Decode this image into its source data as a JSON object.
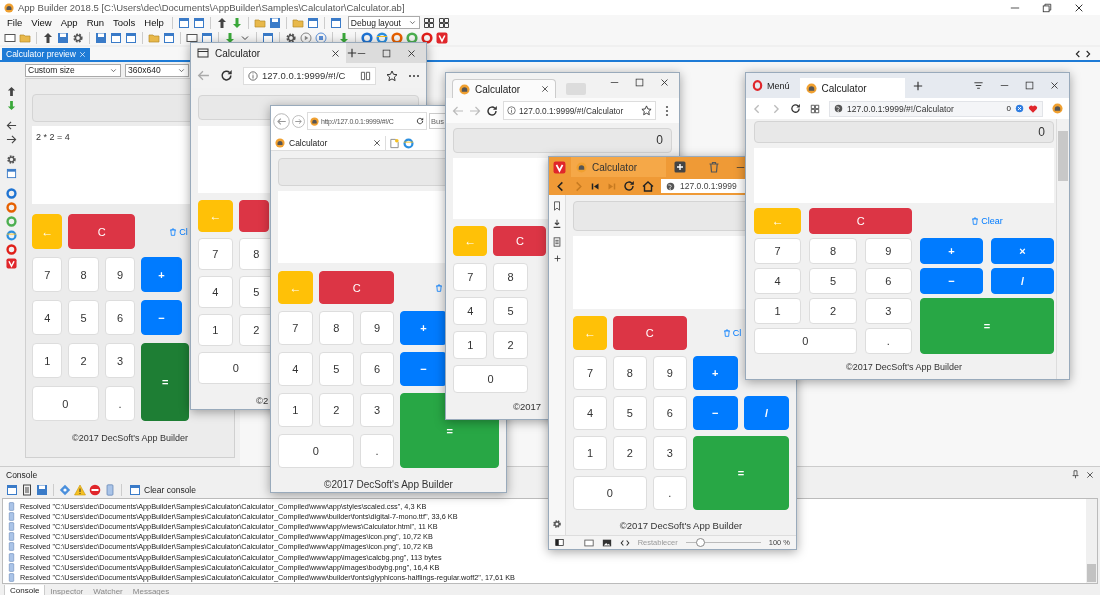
{
  "ide": {
    "title": "App Builder 2018.5 [C:\\Users\\dec\\Documents\\AppBuilder\\Samples\\Calculator\\Calculator.ab]",
    "menu": [
      "File",
      "View",
      "App",
      "Run",
      "Tools",
      "Help"
    ],
    "layout_select": "Debug layout",
    "doc_tabs": [
      {
        "label": "Calculator preview",
        "selected": true
      }
    ],
    "size_select": "Custom size",
    "resolution_select": "360x640",
    "preview": {
      "output": "2 * 2 = 4",
      "back": "←",
      "clear": "C",
      "clear_link": "Cl",
      "keys": [
        [
          {
            "label": "7",
            "kind": "digit"
          },
          {
            "label": "8",
            "kind": "digit"
          },
          {
            "label": "9",
            "kind": "digit"
          },
          {
            "label": "+",
            "kind": "op"
          }
        ],
        [
          {
            "label": "4",
            "kind": "digit"
          },
          {
            "label": "5",
            "kind": "digit"
          },
          {
            "label": "6",
            "kind": "digit"
          },
          {
            "label": "−",
            "kind": "op"
          }
        ],
        [
          {
            "label": "1",
            "kind": "digit"
          },
          {
            "label": "2",
            "kind": "digit"
          },
          {
            "label": "3",
            "kind": "digit"
          },
          {
            "label": "=",
            "kind": "equals",
            "pressed": true
          }
        ],
        [
          {
            "label": "0",
            "kind": "wide"
          },
          {
            "label": ".",
            "kind": "digit"
          }
        ]
      ],
      "footer": "©2017 DecSoft's App Builder"
    },
    "console": {
      "title": "Console",
      "clear_button": "Clear console",
      "lines": [
        "Resolved \"C:\\Users\\dec\\Documents\\AppBuilder\\Samples\\Calculator\\Calculator_Compiled\\www\\app\\styles\\scaled.css\", 4,3 KB",
        "Resolved \"C:\\Users\\dec\\Documents\\AppBuilder\\Samples\\Calculator\\Calculator_Compiled\\www\\builder\\fonts\\digital-7-mono.ttf\", 33,6 KB",
        "Resolved \"C:\\Users\\dec\\Documents\\AppBuilder\\Samples\\Calculator\\Calculator_Compiled\\www\\app\\views\\Calculator.html\", 11 KB",
        "Resolved \"C:\\Users\\dec\\Documents\\AppBuilder\\Samples\\Calculator\\Calculator_Compiled\\www\\app\\images\\icon.png\", 10,72 KB",
        "Resolved \"C:\\Users\\dec\\Documents\\AppBuilder\\Samples\\Calculator\\Calculator_Compiled\\www\\app\\images\\icon.png\", 10,72 KB",
        "Resolved \"C:\\Users\\dec\\Documents\\AppBuilder\\Samples\\Calculator\\Calculator_Compiled\\www\\app\\images\\calcbg.png\", 113 bytes",
        "Resolved \"C:\\Users\\dec\\Documents\\AppBuilder\\Samples\\Calculator\\Calculator_Compiled\\www\\app\\images\\bodybg.png\", 16,4 KB",
        "Resolved \"C:\\Users\\dec\\Documents\\AppBuilder\\Samples\\Calculator\\Calculator_Compiled\\www\\builder\\fonts\\glyphicons-halflings-regular.woff2\", 17,61 KB"
      ],
      "tabs": [
        {
          "label": "Console",
          "selected": true
        },
        {
          "label": "Inspector",
          "selected": false
        },
        {
          "label": "Watcher",
          "selected": false
        },
        {
          "label": "Messages",
          "selected": false
        }
      ]
    }
  },
  "windows": [
    {
      "kind": "edge",
      "tab": "Calculator",
      "address": "127.0.0.1:9999/#!/C",
      "calc": {
        "back": "←",
        "keys": [
          [
            {
              "label": "7",
              "kind": "digit"
            },
            {
              "label": "8",
              "kind": "digit"
            }
          ],
          [
            {
              "label": "4",
              "kind": "digit"
            },
            {
              "label": "5",
              "kind": "digit"
            }
          ],
          [
            {
              "label": "1",
              "kind": "digit"
            },
            {
              "label": "2",
              "kind": "digit"
            }
          ],
          [
            {
              "label": "0",
              "kind": "wide"
            }
          ]
        ],
        "footer": "©2"
      }
    },
    {
      "kind": "ie",
      "address": "http://127.0.0.1:9999/#!/C",
      "search": {
        "placeholder": "Bus"
      },
      "tab": "Calculator",
      "calc": {
        "back": "←",
        "clear": "C",
        "trash_icon": true,
        "keys": [
          [
            {
              "label": "7",
              "kind": "digit"
            },
            {
              "label": "8",
              "kind": "digit"
            },
            {
              "label": "9",
              "kind": "digit"
            },
            {
              "label": "+",
              "kind": "op"
            }
          ],
          [
            {
              "label": "4",
              "kind": "digit"
            },
            {
              "label": "5",
              "kind": "digit"
            },
            {
              "label": "6",
              "kind": "digit"
            },
            {
              "label": "−",
              "kind": "op"
            }
          ],
          [
            {
              "label": "1",
              "kind": "digit"
            },
            {
              "label": "2",
              "kind": "digit"
            },
            {
              "label": "3",
              "kind": "digit"
            },
            {
              "label": "=",
              "kind": "equals",
              "pressed": false
            }
          ],
          [
            {
              "label": "0",
              "kind": "wide"
            },
            {
              "label": ".",
              "kind": "digit"
            }
          ]
        ],
        "footer": "©2017 DecSoft's App Builder"
      }
    },
    {
      "kind": "chrome",
      "tab": "Calculator",
      "address": "127.0.0.1:9999/#!/Calculator",
      "calc": {
        "display": "0",
        "back": "←",
        "clear": "C",
        "keys": [
          [
            {
              "label": "7",
              "kind": "digit"
            },
            {
              "label": "8",
              "kind": "digit"
            }
          ],
          [
            {
              "label": "4",
              "kind": "digit"
            },
            {
              "label": "5",
              "kind": "digit"
            }
          ],
          [
            {
              "label": "1",
              "kind": "digit"
            },
            {
              "label": "2",
              "kind": "digit"
            }
          ],
          [
            {
              "label": "0",
              "kind": "wide"
            }
          ]
        ],
        "footer": "©2017"
      }
    },
    {
      "kind": "vivaldi",
      "tab": "Calculator",
      "address": "127.0.0.1:9999",
      "status": {
        "reset": "Restablecer",
        "zoom_slider": {
          "level": 0.2
        },
        "zoom": "100 %"
      },
      "calc": {
        "back": "←",
        "clear": "C",
        "clear_link": "Cl",
        "keys": [
          [
            {
              "label": "7",
              "kind": "digit"
            },
            {
              "label": "8",
              "kind": "digit"
            },
            {
              "label": "9",
              "kind": "digit"
            },
            {
              "label": "+",
              "kind": "op"
            }
          ],
          [
            {
              "label": "4",
              "kind": "digit"
            },
            {
              "label": "5",
              "kind": "digit"
            },
            {
              "label": "6",
              "kind": "digit"
            },
            {
              "label": "−",
              "kind": "op"
            },
            {
              "label": "/",
              "kind": "op"
            }
          ],
          [
            {
              "label": "1",
              "kind": "digit"
            },
            {
              "label": "2",
              "kind": "digit"
            },
            {
              "label": "3",
              "kind": "digit"
            },
            {
              "label": "=",
              "kind": "equals",
              "pressed": false
            }
          ],
          [
            {
              "label": "0",
              "kind": "wide"
            },
            {
              "label": ".",
              "kind": "digit"
            }
          ]
        ],
        "footer": "©2017 DecSoft's App Builder"
      }
    },
    {
      "kind": "opera",
      "menu": "Menú",
      "tab": "Calculator",
      "address": "127.0.0.1:9999/#!/Calculator",
      "badge": "0",
      "calc": {
        "display": "0",
        "back": "←",
        "clear": "C",
        "clear_link": "Clear",
        "keys": [
          [
            {
              "label": "7",
              "kind": "digit"
            },
            {
              "label": "8",
              "kind": "digit"
            },
            {
              "label": "9",
              "kind": "digit"
            },
            {
              "label": "+",
              "kind": "op"
            },
            {
              "label": "×",
              "kind": "op"
            }
          ],
          [
            {
              "label": "4",
              "kind": "digit"
            },
            {
              "label": "5",
              "kind": "digit"
            },
            {
              "label": "6",
              "kind": "digit"
            },
            {
              "label": "−",
              "kind": "op"
            },
            {
              "label": "/",
              "kind": "op"
            }
          ],
          [
            {
              "label": "1",
              "kind": "digit"
            },
            {
              "label": "2",
              "kind": "digit"
            },
            {
              "label": "3",
              "kind": "digit"
            },
            {
              "label": "=",
              "kind": "equals",
              "pressed": false
            }
          ],
          [
            {
              "label": "0",
              "kind": "wide"
            },
            {
              "label": ".",
              "kind": "digit"
            }
          ]
        ],
        "footer": "©2017 DecSoft's App Builder"
      }
    }
  ]
}
